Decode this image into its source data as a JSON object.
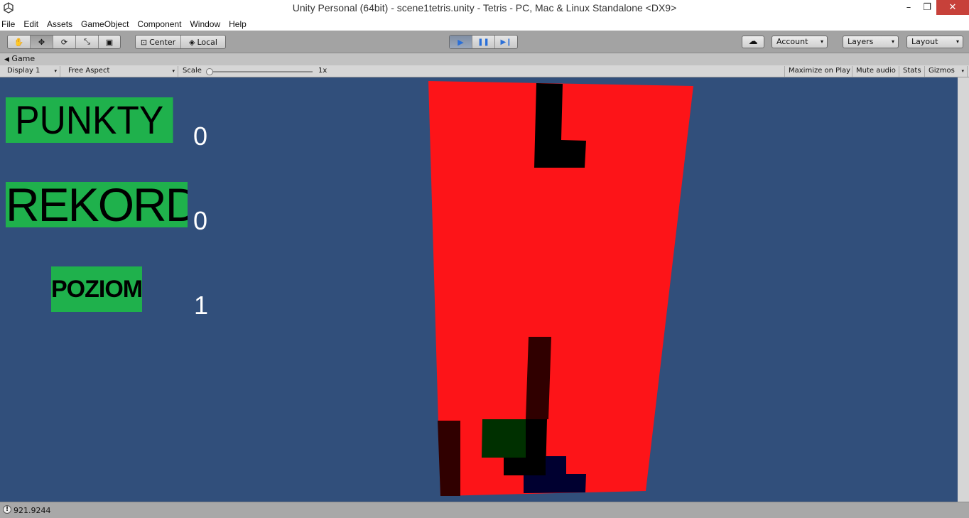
{
  "window": {
    "title": "Unity Personal (64bit) - scene1tetris.unity - Tetris - PC, Mac & Linux Standalone <DX9>",
    "minimize": "–",
    "maximize": "❐",
    "close": "✕"
  },
  "menu": [
    "File",
    "Edit",
    "Assets",
    "GameObject",
    "Component",
    "Window",
    "Help"
  ],
  "toolbar": {
    "tools": [
      {
        "icon": "hand-tool-icon",
        "glyph": "✋"
      },
      {
        "icon": "move-tool-icon",
        "glyph": "✥"
      },
      {
        "icon": "rotate-tool-icon",
        "glyph": "⟳"
      },
      {
        "icon": "scale-tool-icon",
        "glyph": "⤡"
      },
      {
        "icon": "rect-tool-icon",
        "glyph": "▣"
      }
    ],
    "pivot_mode": "Center",
    "pivot_rotation": "Local",
    "play_glyph": "▶",
    "pause_glyph": "❚❚",
    "step_glyph": "▶❙",
    "cloud_glyph": "☁",
    "account": "Account",
    "layers": "Layers",
    "layout": "Layout",
    "dropdown_glyph": "▾"
  },
  "game_panel": {
    "tab": "Game",
    "display": "Display 1",
    "aspect": "Free Aspect",
    "scale_label": "Scale",
    "scale_value": "1x",
    "maximize_on_play": "Maximize on Play",
    "mute_audio": "Mute audio",
    "stats": "Stats",
    "gizmos": "Gizmos"
  },
  "hud": {
    "points_label": "PUNKTY",
    "points_value": "0",
    "record_label": "REKORD",
    "record_value": "0",
    "level_label": "POZIOM",
    "level_value": "1"
  },
  "colors": {
    "game_background": "#314f7b",
    "board": "#fd1418",
    "label_box": "#1fb14c",
    "play_active": "#3d7fe0"
  },
  "status": {
    "icon": "info-icon",
    "text": "921.9244"
  }
}
